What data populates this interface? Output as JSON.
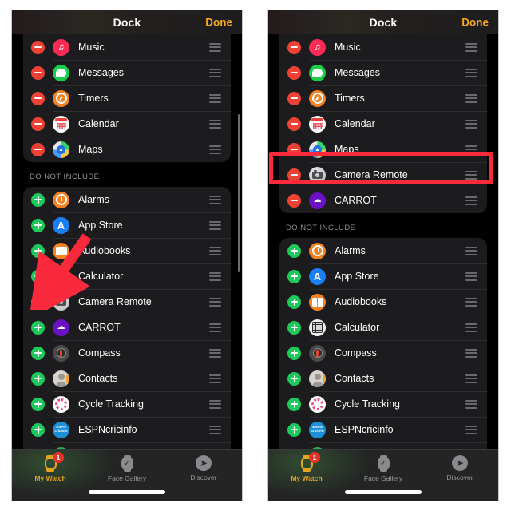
{
  "panels": [
    {
      "id": "before",
      "navbar": {
        "title": "Dock",
        "done_label": "Done"
      },
      "dock_section": {
        "items": [
          {
            "label": "Music",
            "icon": "music-icon",
            "control": "remove"
          },
          {
            "label": "Messages",
            "icon": "messages-icon",
            "control": "remove"
          },
          {
            "label": "Timers",
            "icon": "timers-icon",
            "control": "remove"
          },
          {
            "label": "Calendar",
            "icon": "calendar-icon",
            "control": "remove"
          },
          {
            "label": "Maps",
            "icon": "maps-icon",
            "control": "remove"
          }
        ]
      },
      "exclude_section": {
        "header": "DO NOT INCLUDE",
        "items": [
          {
            "label": "Alarms",
            "icon": "alarms-icon",
            "control": "add"
          },
          {
            "label": "App Store",
            "icon": "app-store-icon",
            "control": "add"
          },
          {
            "label": "Audiobooks",
            "icon": "audiobooks-icon",
            "control": "add"
          },
          {
            "label": "Calculator",
            "icon": "calculator-icon",
            "control": "add"
          },
          {
            "label": "Camera Remote",
            "icon": "camera-remote-icon",
            "control": "add"
          },
          {
            "label": "CARROT",
            "icon": "carrot-icon",
            "control": "add"
          },
          {
            "label": "Compass",
            "icon": "compass-icon",
            "control": "add"
          },
          {
            "label": "Contacts",
            "icon": "contacts-icon",
            "control": "add"
          },
          {
            "label": "Cycle Tracking",
            "icon": "cycle-tracking-icon",
            "control": "add"
          },
          {
            "label": "ESPNcricinfo",
            "icon": "espncricinfo-icon",
            "control": "add"
          },
          {
            "label": "",
            "icon": "find-devices-icon",
            "control": "add"
          }
        ]
      },
      "tabbar": {
        "tabs": [
          {
            "label": "My Watch",
            "icon": "watch-icon",
            "badge": "1",
            "active": true
          },
          {
            "label": "Face Gallery",
            "icon": "gallery-icon",
            "badge": "",
            "active": false
          },
          {
            "label": "Discover",
            "icon": "compass-discover-icon",
            "badge": "",
            "active": false
          }
        ]
      },
      "annotation": {
        "type": "arrow",
        "color": "#fa2a3c",
        "points_to": "Camera Remote add button"
      }
    },
    {
      "id": "after",
      "navbar": {
        "title": "Dock",
        "done_label": "Done"
      },
      "dock_section": {
        "items": [
          {
            "label": "Music",
            "icon": "music-icon",
            "control": "remove"
          },
          {
            "label": "Messages",
            "icon": "messages-icon",
            "control": "remove"
          },
          {
            "label": "Timers",
            "icon": "timers-icon",
            "control": "remove"
          },
          {
            "label": "Calendar",
            "icon": "calendar-icon",
            "control": "remove"
          },
          {
            "label": "Maps",
            "icon": "maps-icon",
            "control": "remove"
          },
          {
            "label": "Camera Remote",
            "icon": "camera-remote-icon",
            "control": "remove"
          },
          {
            "label": "CARROT",
            "icon": "carrot-icon",
            "control": "remove"
          }
        ]
      },
      "exclude_section": {
        "header": "DO NOT INCLUDE",
        "items": [
          {
            "label": "Alarms",
            "icon": "alarms-icon",
            "control": "add"
          },
          {
            "label": "App Store",
            "icon": "app-store-icon",
            "control": "add"
          },
          {
            "label": "Audiobooks",
            "icon": "audiobooks-icon",
            "control": "add"
          },
          {
            "label": "Calculator",
            "icon": "calculator-icon",
            "control": "add"
          },
          {
            "label": "Compass",
            "icon": "compass-icon",
            "control": "add"
          },
          {
            "label": "Contacts",
            "icon": "contacts-icon",
            "control": "add"
          },
          {
            "label": "Cycle Tracking",
            "icon": "cycle-tracking-icon",
            "control": "add"
          },
          {
            "label": "ESPNcricinfo",
            "icon": "espncricinfo-icon",
            "control": "add"
          },
          {
            "label": "",
            "icon": "find-devices-icon",
            "control": "add"
          }
        ]
      },
      "tabbar": {
        "tabs": [
          {
            "label": "My Watch",
            "icon": "watch-icon",
            "badge": "1",
            "active": true
          },
          {
            "label": "Face Gallery",
            "icon": "gallery-icon",
            "badge": "",
            "active": false
          },
          {
            "label": "Discover",
            "icon": "compass-discover-icon",
            "badge": "",
            "active": false
          }
        ]
      },
      "annotation": {
        "type": "highlight-box",
        "color": "#fa2a3c",
        "target": "Camera Remote"
      }
    }
  ],
  "colors": {
    "accent_done": "#f7a61b",
    "remove_button": "#ef4136",
    "add_button": "#1ec95c",
    "annotation": "#fa2a3c",
    "panel_background": "#000000",
    "group_background": "#1c1c1e",
    "tab_active": "#e7a41e"
  }
}
